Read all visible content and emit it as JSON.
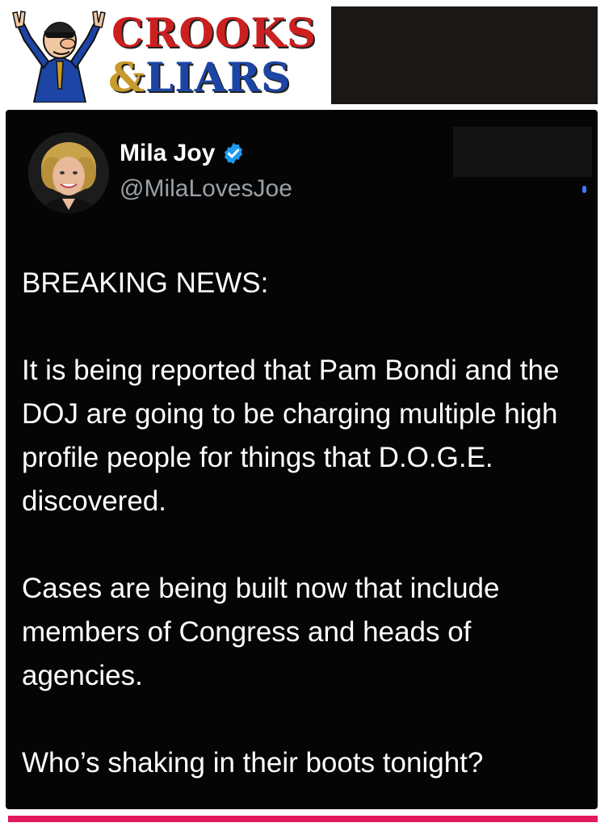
{
  "banner": {
    "logo_line1": "CROOKS",
    "logo_amp": "&",
    "logo_line2": "LIARS",
    "colors": {
      "crooks_red": "#cc1f1f",
      "amp_gold": "#c79a2a",
      "liars_blue": "#1c45a6",
      "banner_bg": "#1a1717"
    },
    "mascot_icon": "mascot-crook-icon"
  },
  "tweet": {
    "display_name": "Mila Joy",
    "verified_icon": "verified-badge-icon",
    "handle": "@MilaLovesJoe",
    "paragraphs": [
      "BREAKING NEWS:",
      "It is being reported that Pam Bondi and the DOJ are going to be charging multiple high profile people for things that D.O.G.E. discovered.",
      "Cases are being built now that include members of Congress and heads of agencies.",
      "Who’s shaking in their boots tonight?"
    ],
    "colors": {
      "card_bg": "#050505",
      "text": "#ffffff",
      "handle": "#9aa0a6",
      "verified": "#1d9bf0"
    }
  },
  "footer": {
    "rule_color": "#e2195b"
  }
}
